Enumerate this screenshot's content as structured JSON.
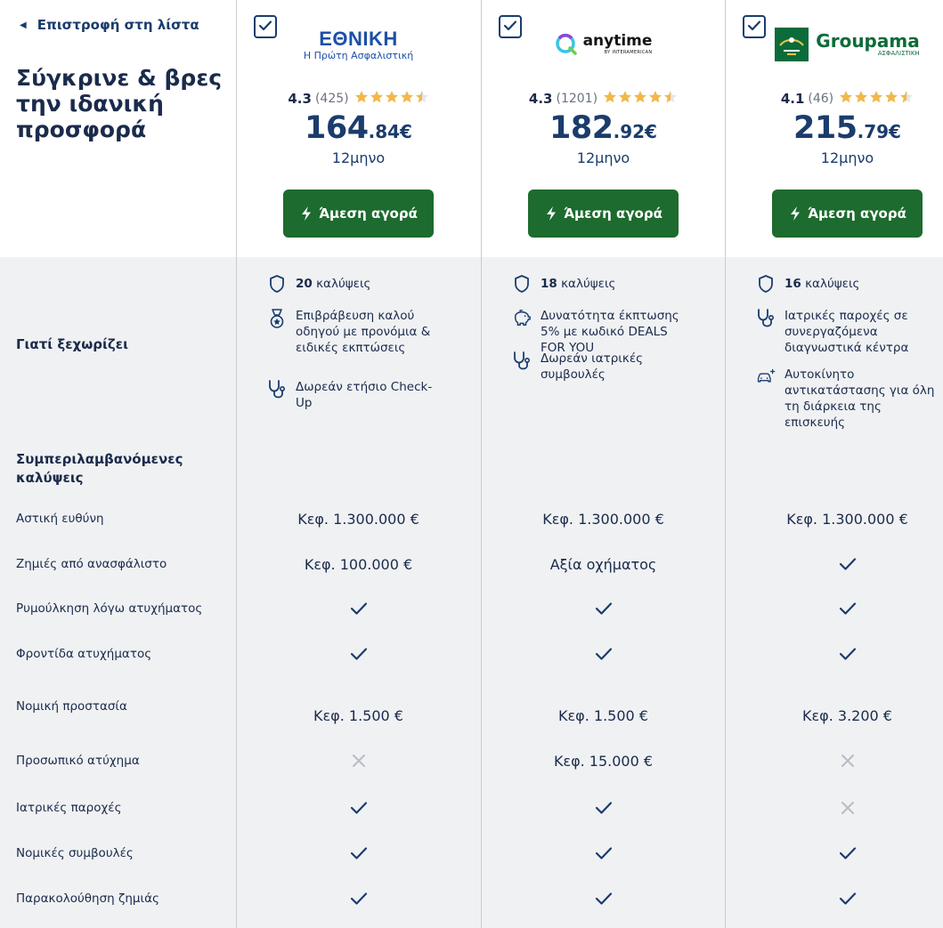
{
  "nav": {
    "back_label": "Επιστροφή στη λίστα"
  },
  "page": {
    "heading": "Σύγκρινε & βρες την ιδανική προσφορά"
  },
  "colors": {
    "primary": "#1b3c6c",
    "buy_button": "#1d6b2e",
    "star": "#f0b84a",
    "cross": "#b8bcc4"
  },
  "sections": {
    "why_label": "Γιατί ξεχωρίζει",
    "covers_label": "Συμπεριλαμβανόμενες καλύψεις"
  },
  "coverage_rows": [
    "Αστική ευθύνη",
    "Ζημιές από ανασφάλιστο",
    "Ρυμούλκηση λόγω ατυχήματος",
    "Φροντίδα ατυχήματος",
    "Νομική προστασία",
    "Προσωπικό ατύχημα",
    "Ιατρικές παροχές",
    "Νομικές συμβουλές",
    "Παρακολούθηση ζημιάς"
  ],
  "offers": [
    {
      "logo": {
        "name": "ΕΘΝΙΚΗ",
        "tagline": "Η Πρώτη Ασφαλιστική"
      },
      "rating": "4.3",
      "reviews": "(425)",
      "stars": 4.5,
      "price_int": "164",
      "price_dec": ".84€",
      "period": "12μηνο",
      "buy_label": "Άμεση αγορά",
      "coverage_count": "20",
      "coverage_word": "καλύψεις",
      "features": [
        {
          "icon": "medal-icon",
          "text": "Επιβράβευση καλού οδηγού με προνόμια & ειδικές εκπτώσεις"
        },
        {
          "icon": "stethoscope-icon",
          "text": "Δωρεάν ετήσιο Check-Up"
        }
      ],
      "values": [
        "Κεφ. 1.300.000 €",
        "Κεφ. 100.000 €",
        "check",
        "check",
        "Κεφ. 1.500 €",
        "cross",
        "check",
        "check",
        "check"
      ]
    },
    {
      "logo": {
        "name": "anytime",
        "tagline": "BY INTERAMERICAN"
      },
      "rating": "4.3",
      "reviews": "(1201)",
      "stars": 4.5,
      "price_int": "182",
      "price_dec": ".92€",
      "period": "12μηνο",
      "buy_label": "Άμεση αγορά",
      "coverage_count": "18",
      "coverage_word": "καλύψεις",
      "features": [
        {
          "icon": "piggy-bank-icon",
          "text": "Δυνατότητα έκπτωσης 5% με κωδικό DEALS FOR YOU"
        },
        {
          "icon": "stethoscope-icon",
          "text": "Δωρεάν ιατρικές συμβουλές"
        }
      ],
      "values": [
        "Κεφ. 1.300.000 €",
        "Αξία οχήματος",
        "check",
        "check",
        "Κεφ. 1.500 €",
        "Κεφ. 15.000 €",
        "check",
        "check",
        "check"
      ]
    },
    {
      "logo": {
        "name": "Groupama",
        "tagline": "ΑΣΦΑΛΙΣΤΙΚΗ"
      },
      "rating": "4.1",
      "reviews": "(46)",
      "stars": 4.5,
      "price_int": "215",
      "price_dec": ".79€",
      "period": "12μηνο",
      "buy_label": "Άμεση αγορά",
      "coverage_count": "16",
      "coverage_word": "καλύψεις",
      "features": [
        {
          "icon": "stethoscope-icon",
          "text": "Ιατρικές παροχές σε συνεργαζόμενα διαγνωστικά κέντρα"
        },
        {
          "icon": "car-sparkle-icon",
          "text": "Αυτοκίνητο αντικατάστασης για όλη τη διάρκεια της επισκευής"
        }
      ],
      "values": [
        "Κεφ. 1.300.000 €",
        "check",
        "check",
        "check",
        "Κεφ. 3.200 €",
        "cross",
        "cross",
        "check",
        "check"
      ]
    }
  ]
}
